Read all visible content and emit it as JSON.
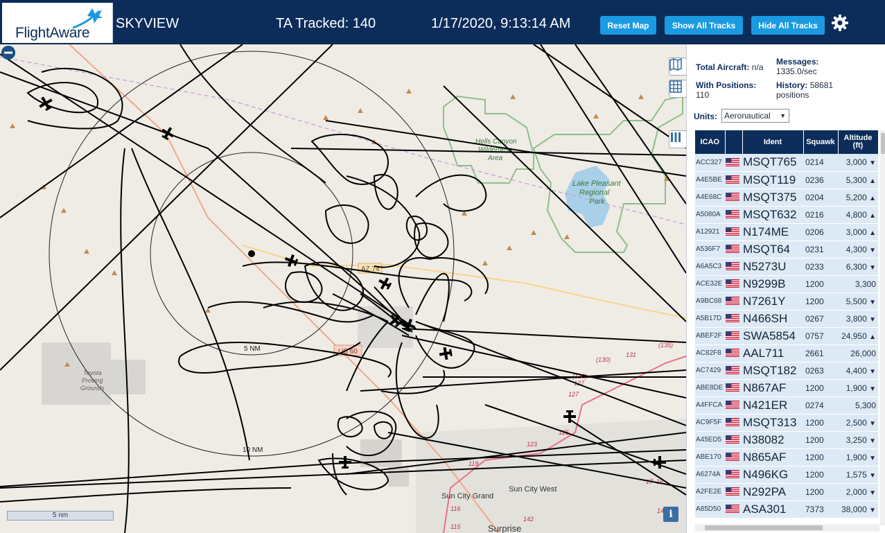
{
  "header": {
    "logo_text": "FlightAware",
    "title": "SKYVIEW",
    "tracked": "TA Tracked: 140",
    "datetime": "1/17/2020, 9:13:14 AM",
    "reset_label": "Reset Map",
    "show_label": "Show All Tracks",
    "hide_label": "Hide All Tracks"
  },
  "map": {
    "labels": {
      "hells_canyon_1": "Hells Canyon",
      "hells_canyon_2": "Wilderness",
      "hells_canyon_3": "Area",
      "lake_1": "Lake Pleasant",
      "lake_2": "Regional",
      "lake_3": "Park",
      "toyota_1": "Toyota",
      "toyota_2": "Proving",
      "toyota_3": "Grounds",
      "az74": "AZ 74",
      "us60": "US 60",
      "ring_5": "5 NM",
      "ring_10": "10 NM",
      "sun_city_grand": "Sun City Grand",
      "sun_city_west": "Sun City West",
      "surprise": "Surprise",
      "r119": "119",
      "r123": "123",
      "r125": "125",
      "r127a": "127",
      "r127b": "127",
      "r128": "(128)",
      "r130": "(130)",
      "r131": "131",
      "r135": "(135)",
      "r116": "116",
      "r115": "115",
      "r142": "142",
      "r17": "17",
      "r16": "16",
      "r14": "14"
    },
    "scale_label": "5 nm",
    "info_label": "i"
  },
  "panel": {
    "total_label": "Total Aircraft:",
    "total_value": "n/a",
    "messages_label": "Messages:",
    "messages_value": "1335.0/sec",
    "positions_label": "With Positions:",
    "positions_value": "110",
    "history_label": "History:",
    "history_value_1": "58681",
    "history_value_2": "positions",
    "units_label": "Units:",
    "units_value": "Aeronautical",
    "columns": {
      "icao": "ICAO",
      "ident": "Ident",
      "squawk": "Squawk",
      "altitude_1": "Altitude",
      "altitude_2": "(ft)"
    },
    "rows": [
      {
        "icao": "ACC327",
        "ident": "MSQT765",
        "squawk": "0214",
        "altitude": "3,000",
        "trend": "▼"
      },
      {
        "icao": "A4E5BE",
        "ident": "MSQT119",
        "squawk": "0236",
        "altitude": "5,300",
        "trend": "▲"
      },
      {
        "icao": "A4E68C",
        "ident": "MSQT375",
        "squawk": "0204",
        "altitude": "5,200",
        "trend": "▲"
      },
      {
        "icao": "A5080A",
        "ident": "MSQT632",
        "squawk": "0216",
        "altitude": "4,800",
        "trend": "▲"
      },
      {
        "icao": "A12921",
        "ident": "N174ME",
        "squawk": "0206",
        "altitude": "3,000",
        "trend": "▲"
      },
      {
        "icao": "A536F7",
        "ident": "MSQT64",
        "squawk": "0231",
        "altitude": "4,300",
        "trend": "▼"
      },
      {
        "icao": "A6A5C3",
        "ident": "N5273U",
        "squawk": "0233",
        "altitude": "6,300",
        "trend": "▼"
      },
      {
        "icao": "ACE32E",
        "ident": "N9299B",
        "squawk": "1200",
        "altitude": "3,300",
        "trend": ""
      },
      {
        "icao": "A9BC68",
        "ident": "N7261Y",
        "squawk": "1200",
        "altitude": "5,500",
        "trend": "▼"
      },
      {
        "icao": "A5B17D",
        "ident": "N466SH",
        "squawk": "0267",
        "altitude": "3,800",
        "trend": "▼"
      },
      {
        "icao": "ABEF2F",
        "ident": "SWA5854",
        "squawk": "0757",
        "altitude": "24,950",
        "trend": "▲"
      },
      {
        "icao": "AC82F8",
        "ident": "AAL711",
        "squawk": "2661",
        "altitude": "26,000",
        "trend": ""
      },
      {
        "icao": "AC7429",
        "ident": "MSQT182",
        "squawk": "0263",
        "altitude": "4,400",
        "trend": "▼"
      },
      {
        "icao": "ABE8DE",
        "ident": "N867AF",
        "squawk": "1200",
        "altitude": "1,900",
        "trend": "▼"
      },
      {
        "icao": "A4FFCA",
        "ident": "N421ER",
        "squawk": "0274",
        "altitude": "5,300",
        "trend": ""
      },
      {
        "icao": "AC9F5F",
        "ident": "MSQT313",
        "squawk": "1200",
        "altitude": "2,500",
        "trend": "▼"
      },
      {
        "icao": "A45ED5",
        "ident": "N38082",
        "squawk": "1200",
        "altitude": "3,250",
        "trend": "▼"
      },
      {
        "icao": "ABE170",
        "ident": "N865AF",
        "squawk": "1200",
        "altitude": "1,900",
        "trend": "▼"
      },
      {
        "icao": "A6274A",
        "ident": "N496KG",
        "squawk": "1200",
        "altitude": "1,575",
        "trend": "▼"
      },
      {
        "icao": "A2FE2E",
        "ident": "N292PA",
        "squawk": "1200",
        "altitude": "2,000",
        "trend": "▼"
      },
      {
        "icao": "A85D50",
        "ident": "ASA301",
        "squawk": "7373",
        "altitude": "38,000",
        "trend": "▼"
      }
    ]
  },
  "colors": {
    "header_bg": "#0c2d5a",
    "button_bg": "#1a9ae0",
    "row_bg": "#ddeaf6",
    "track": "#000000",
    "map_bg": "#efece6"
  }
}
